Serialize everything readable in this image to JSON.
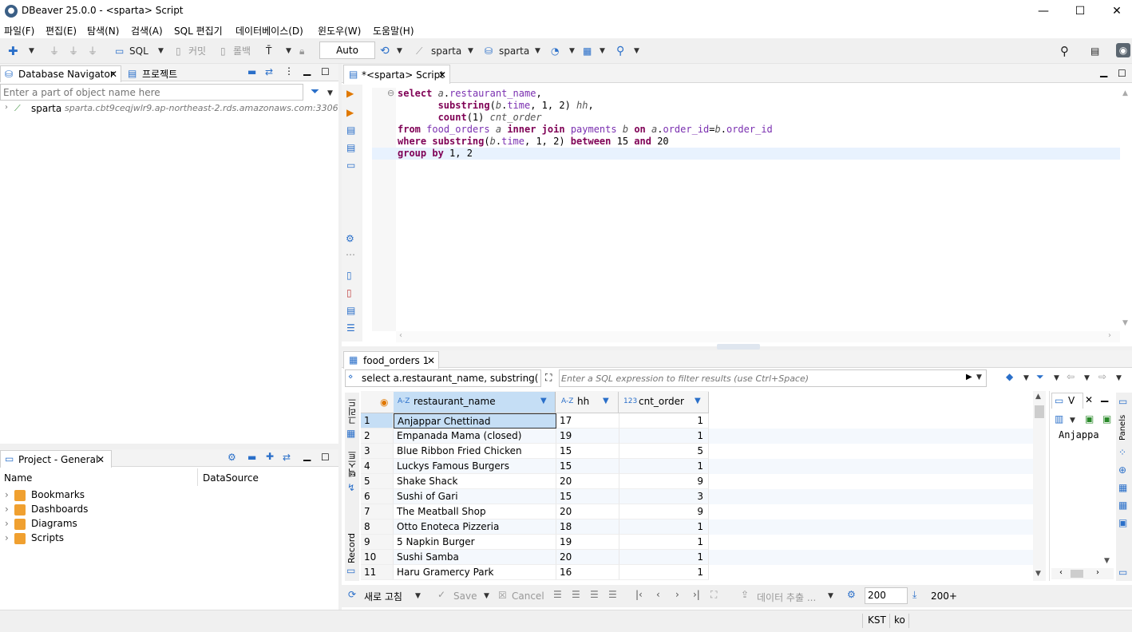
{
  "window": {
    "title": "DBeaver 25.0.0 - <sparta> Script"
  },
  "menu": [
    "파일(F)",
    "편집(E)",
    "탐색(N)",
    "검색(A)",
    "SQL 편집기",
    "데이터베이스(D)",
    "윈도우(W)",
    "도움말(H)"
  ],
  "toolbar": {
    "sql_label": "SQL",
    "commit_label": "커밋",
    "rollback_label": "롤백",
    "auto_label": "Auto",
    "datasource_label": "sparta",
    "schema_label": "sparta"
  },
  "navigator": {
    "tab_label": "Database Navigator",
    "tab2_label": "프로젝트",
    "filter_placeholder": "Enter a part of object name here",
    "connection_name": "sparta",
    "connection_host": "sparta.cbt9ceqjwlr9.ap-northeast-2.rds.amazonaws.com:3306"
  },
  "project": {
    "tab_label": "Project - General",
    "col_name": "Name",
    "col_datasource": "DataSource",
    "items": [
      "Bookmarks",
      "Dashboards",
      "Diagrams",
      "Scripts"
    ]
  },
  "editor": {
    "tab_label": "*<sparta> Script"
  },
  "results": {
    "tab_label": "food_orders 1",
    "query_preview": "select a.restaurant_name, substring(b.time",
    "filter_placeholder": "Enter a SQL expression to filter results (use Ctrl+Space)",
    "columns": [
      {
        "type": "A-Z",
        "name": "restaurant_name"
      },
      {
        "type": "A-Z",
        "name": "hh"
      },
      {
        "type": "123",
        "name": "cnt_order"
      }
    ],
    "rows": [
      [
        "1",
        "Anjappar Chettinad",
        "17",
        "1"
      ],
      [
        "2",
        "Empanada Mama (closed)",
        "19",
        "1"
      ],
      [
        "3",
        "Blue Ribbon Fried Chicken",
        "15",
        "5"
      ],
      [
        "4",
        "Luckys Famous Burgers",
        "15",
        "1"
      ],
      [
        "5",
        "Shake Shack",
        "20",
        "9"
      ],
      [
        "6",
        "Sushi of Gari",
        "15",
        "3"
      ],
      [
        "7",
        "The Meatball Shop",
        "20",
        "9"
      ],
      [
        "8",
        "Otto Enoteca Pizzeria",
        "18",
        "1"
      ],
      [
        "9",
        "5 Napkin Burger",
        "19",
        "1"
      ],
      [
        "10",
        "Sushi Samba",
        "20",
        "1"
      ],
      [
        "11",
        "Haru Gramercy Park",
        "16",
        "1"
      ]
    ],
    "side_tabs": [
      "그리드",
      "텍스트",
      "Record"
    ],
    "value_panel_tab": "V",
    "value_panel_text": "Anjappa",
    "panels_label": "Panels",
    "bottom": {
      "refresh": "새로 고침",
      "save": "Save",
      "cancel": "Cancel",
      "export": "데이터 추출 ...",
      "fetch_size": "200",
      "fetch_more": "200+"
    }
  },
  "status": {
    "timezone": "KST",
    "locale": "ko"
  }
}
